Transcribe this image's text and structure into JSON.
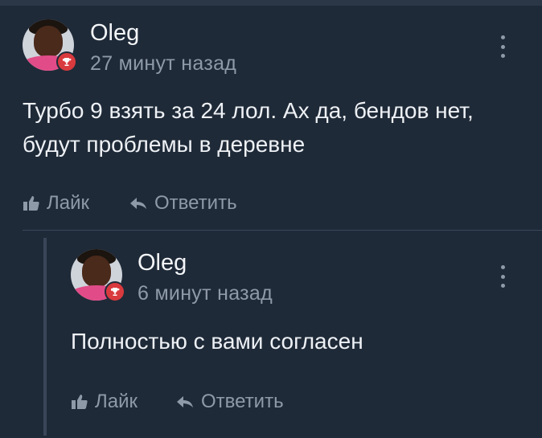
{
  "comments": [
    {
      "author": "Oleg",
      "timestamp": "27 минут назад",
      "text": "Турбо 9 взять за 24 лол. Ах да, бендов нет, будут проблемы в деревне",
      "like_label": "Лайк",
      "reply_label": "Ответить"
    },
    {
      "author": "Oleg",
      "timestamp": "6 минут назад",
      "text": "Полностью с вами согласен",
      "like_label": "Лайк",
      "reply_label": "Ответить"
    }
  ],
  "icons": {
    "more": "more-vertical-icon",
    "badge": "trophy-icon",
    "like": "thumbs-up-icon",
    "reply": "reply-arrow-icon"
  },
  "colors": {
    "background": "#1f2a38",
    "text": "#eef1f5",
    "muted": "#8f9aa8",
    "badge": "#d93a3e",
    "thread_line": "#3a4658"
  }
}
